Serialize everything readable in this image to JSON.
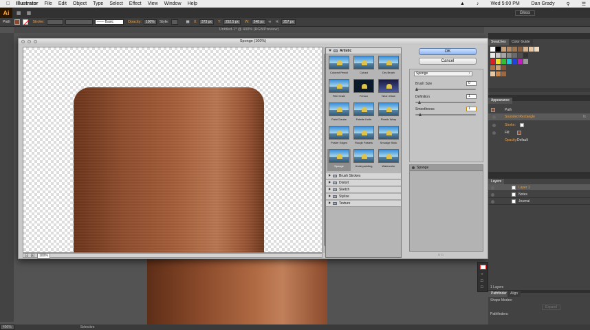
{
  "menubar": {
    "apple": "",
    "app": "Illustrator",
    "items": [
      "File",
      "Edit",
      "Object",
      "Type",
      "Select",
      "Effect",
      "View",
      "Window",
      "Help"
    ],
    "clock": "Wed 5:00 PM",
    "user": "Dan Grady"
  },
  "appbar": {
    "logo": "Ai",
    "workspace": "Gloss"
  },
  "controlbar": {
    "selection": "Path",
    "stroke_label": "Stroke:",
    "brush": "Basic",
    "opacity_label": "Opacity:",
    "opacity": "100%",
    "style_label": "Style:",
    "x": "373 px",
    "y": "252.5 px",
    "w": "248 px",
    "h": "257 px"
  },
  "doc_title": "Untitled-1* @ 400% (RGB/Preview)",
  "dialog": {
    "title": "Sponge (100%)",
    "ok": "OK",
    "cancel": "Cancel",
    "zoom": "100%",
    "filter": "Sponge",
    "settings": [
      {
        "label": "Brush Size",
        "value": "0",
        "pos": 0.0
      },
      {
        "label": "Definition",
        "value": "1",
        "pos": 0.04
      },
      {
        "label": "Smoothness",
        "value": "1",
        "pos": 0.06
      }
    ],
    "layer_name": "Sponge",
    "gallery_open": "Artistic",
    "thumbs": [
      "Colored Pencil",
      "Cutout",
      "Dry Brush",
      "Film Grain",
      "Fresco",
      "Neon Glow",
      "Paint Daubs",
      "Palette Knife",
      "Plastic Wrap",
      "Poster Edges",
      "Rough Pastels",
      "Smudge Stick",
      "Sponge",
      "Underpainting",
      "Watercolor"
    ],
    "categories": [
      "Brush Strokes",
      "Distort",
      "Sketch",
      "Stylize",
      "Texture"
    ]
  },
  "status": {
    "zoom": "400%",
    "tool": "Selection"
  },
  "panels": {
    "swatches_tab": "Swatches",
    "color_guide_tab": "Color Guide",
    "appearance_tab": "Appearance",
    "appearance": {
      "path": "Path",
      "effect": "Sounded Rectangle",
      "stroke": "Stroke:",
      "fill": "Fill:",
      "opacity": "Opacity:",
      "opacity_val": "Default"
    },
    "layers_tab": "Layers",
    "layers": [
      "Layer 1",
      "Notes",
      "Journal"
    ],
    "layer_count": "1 Layers",
    "pathfinder_tab": "Pathfinder",
    "align_tab": "Align",
    "shape_modes": "Shape Modes:",
    "pathfinders": "Pathfinders:",
    "expand": "Expand"
  },
  "colors": {
    "accent": "#e8a24a",
    "brand": "#f7a23b",
    "ok": "#8fb6ee"
  }
}
